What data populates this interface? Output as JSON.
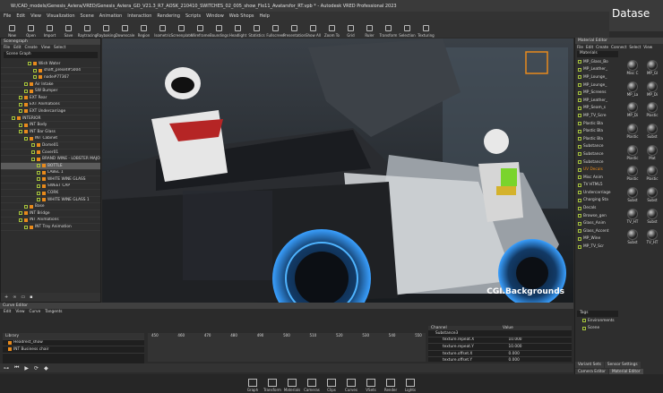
{
  "window": {
    "title": "W:/CAD_models/Genesis_Aviera/VRED/Genesis_Aviera_GD_V21.3_R7_AOSK_210410_SWITCHES_02_005_show_Flo11_Avatarsfor_RT.vpb * - Autodesk VRED Professional 2023",
    "brand": "Datase"
  },
  "menu": [
    "File",
    "Edit",
    "View",
    "Visualization",
    "Scene",
    "Animation",
    "Interaction",
    "Rendering",
    "Scripts",
    "Window",
    "Web Shops",
    "Help"
  ],
  "toolbar": [
    "New",
    "Open",
    "Import",
    "Save",
    "Raytracing",
    "Raybaking",
    "Downscale",
    "Region",
    "Isometric",
    "Screenplate",
    "Wireframe",
    "Boundings",
    "Headlight",
    "Statistics",
    "Fullscreen",
    "Presentation",
    "Show All",
    "Zoom To",
    "Grid",
    "Ruler",
    "Transform",
    "Selection",
    "Texturing"
  ],
  "scenegraph": {
    "title": "Scenegraph",
    "menu": [
      "File",
      "Edit",
      "Create",
      "View",
      "Select"
    ],
    "search": "Scene Graph",
    "rows": [
      "Wish Water",
      "shaft_preset#5004",
      "node#77367",
      "Air Intake",
      "SW Bumper",
      "EXT Rear",
      "EXT Animations",
      "EXT Undercarriage",
      "INTERIOR",
      "INT Body",
      "INT Bar Glass",
      "INT Cabinet",
      "Dome01",
      "Cover01",
      "BRAND WINE - LOBSTER MAJOR",
      "BOTTLE",
      "LABEL 1",
      "WHITE WINE GLASS",
      "SWEET CAP",
      "CORK",
      "WHITE WINE GLASS 1",
      "Base",
      "INT Bridge",
      "INT Animations",
      "INT Tray Animation"
    ]
  },
  "viewport": {
    "watermark": "CGI.Backgrounds"
  },
  "curveeditor": {
    "title": "Curve Editor",
    "menu": [
      "Edit",
      "View",
      "Curve",
      "Tangents"
    ],
    "library": "Library",
    "item1": "Headrest_show",
    "item2": "INT Business chair",
    "ticks": [
      "450",
      "460",
      "470",
      "480",
      "490",
      "500",
      "510",
      "520",
      "530",
      "540",
      "550"
    ],
    "table": {
      "headers": [
        "Channel",
        "Value"
      ],
      "rows": [
        [
          "Substance3",
          ""
        ],
        [
          "texture.repeat.X",
          "10.000"
        ],
        [
          "texture.repeat.Y",
          "10.000"
        ],
        [
          "texture.offset.X",
          "0.000"
        ],
        [
          "texture.offset.Y",
          "0.000"
        ]
      ]
    }
  },
  "material": {
    "title": "Material Editor",
    "menu": [
      "File",
      "Edit",
      "Create",
      "Connect",
      "Select",
      "View"
    ],
    "filter": "Materials",
    "items": [
      "MP_Glass_Bo",
      "MP_Leather_",
      "MP_Lounge_",
      "MP_Lounge_",
      "MP_Screens",
      "MP_Leather_",
      "MP_Seam_s",
      "MP_TV_Scre",
      "Plastic Bla",
      "Plastic Bla",
      "Plastic Bla",
      "Substance",
      "Substance",
      "Substance",
      "UV Decals",
      "Misc Anim",
      "TV HTML5",
      "Undercarriage",
      "Charging Sta",
      "Decals",
      "Browse_gen",
      "Glass_Anim",
      "Glass_Accent",
      "MP_Wine",
      "MP_TV_Scr"
    ],
    "thumbs": [
      "Misc C",
      "MP_Gl",
      "MP_La",
      "MP_Di",
      "MP_Di",
      "Plastic",
      "Plastic",
      "Subst",
      "Plastic",
      "Mat",
      "Plastic",
      "Plastic",
      "Subst",
      "Subst",
      "TV_HT",
      "Subst",
      "Subst",
      "TV_HT"
    ],
    "tags": "Tags",
    "tagrows": [
      "Environments",
      "Scene"
    ],
    "tabs": [
      "Variant Sets",
      "Sensor Settings",
      "Camera Editor",
      "Material Editor"
    ]
  },
  "bottom": [
    "Graph",
    "Transform",
    "Materials",
    "Cameras",
    "Clips",
    "Curves",
    "VSets",
    "Render",
    "Lights"
  ],
  "colors": {
    "accent": "#e88a1c",
    "check": "#a7c53b"
  }
}
